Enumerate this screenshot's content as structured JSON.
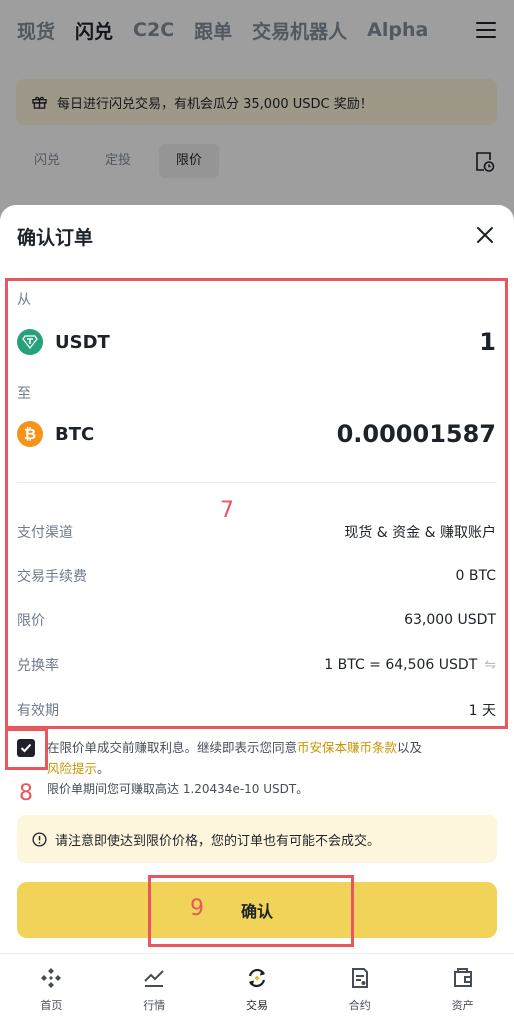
{
  "topnav": {
    "items": [
      "现货",
      "闪兑",
      "C2C",
      "跟单",
      "交易机器人",
      "Alpha"
    ],
    "active_index": 1
  },
  "banner": {
    "text": "每日进行闪兑交易，有机会瓜分 35,000 USDC 奖励！"
  },
  "subtabs": {
    "items": [
      "闪兑",
      "定投",
      "限价"
    ],
    "active_index": 2
  },
  "sheet": {
    "title": "确认订单",
    "from_label": "从",
    "from_coin": "USDT",
    "from_amount": "1",
    "to_label": "至",
    "to_coin": "BTC",
    "to_amount": "0.00001587",
    "details": [
      {
        "key": "支付渠道",
        "value": "现货 & 资金 & 赚取账户"
      },
      {
        "key": "交易手续费",
        "value": "0 BTC"
      },
      {
        "key": "限价",
        "value": "63,000 USDT"
      },
      {
        "key": "兑换率",
        "value": "1 BTC = 64,506 USDT"
      },
      {
        "key": "有效期",
        "value": "1 天"
      }
    ],
    "terms": {
      "prefix": "在限价单成交前赚取利息。继续即表示您同意",
      "link1": "币安保本赚币条款",
      "middle": "以及",
      "link2": "风险提示",
      "suffix": "。"
    },
    "earn_text": "限价单期间您可赚取高达 1.20434e-10 USDT。",
    "notice": "请注意即使达到限价价格，您的订单也有可能不会成交。",
    "confirm_label": "确认"
  },
  "annotations": {
    "box7": "7",
    "box8": "8",
    "box9": "9",
    "color": "#e8575d"
  },
  "colors": {
    "accent": "#f0d358",
    "usdt": "#26a17b",
    "btc": "#f7931a"
  },
  "bottomnav": {
    "items": [
      "首页",
      "行情",
      "交易",
      "合约",
      "资产"
    ],
    "active_index": 2
  }
}
